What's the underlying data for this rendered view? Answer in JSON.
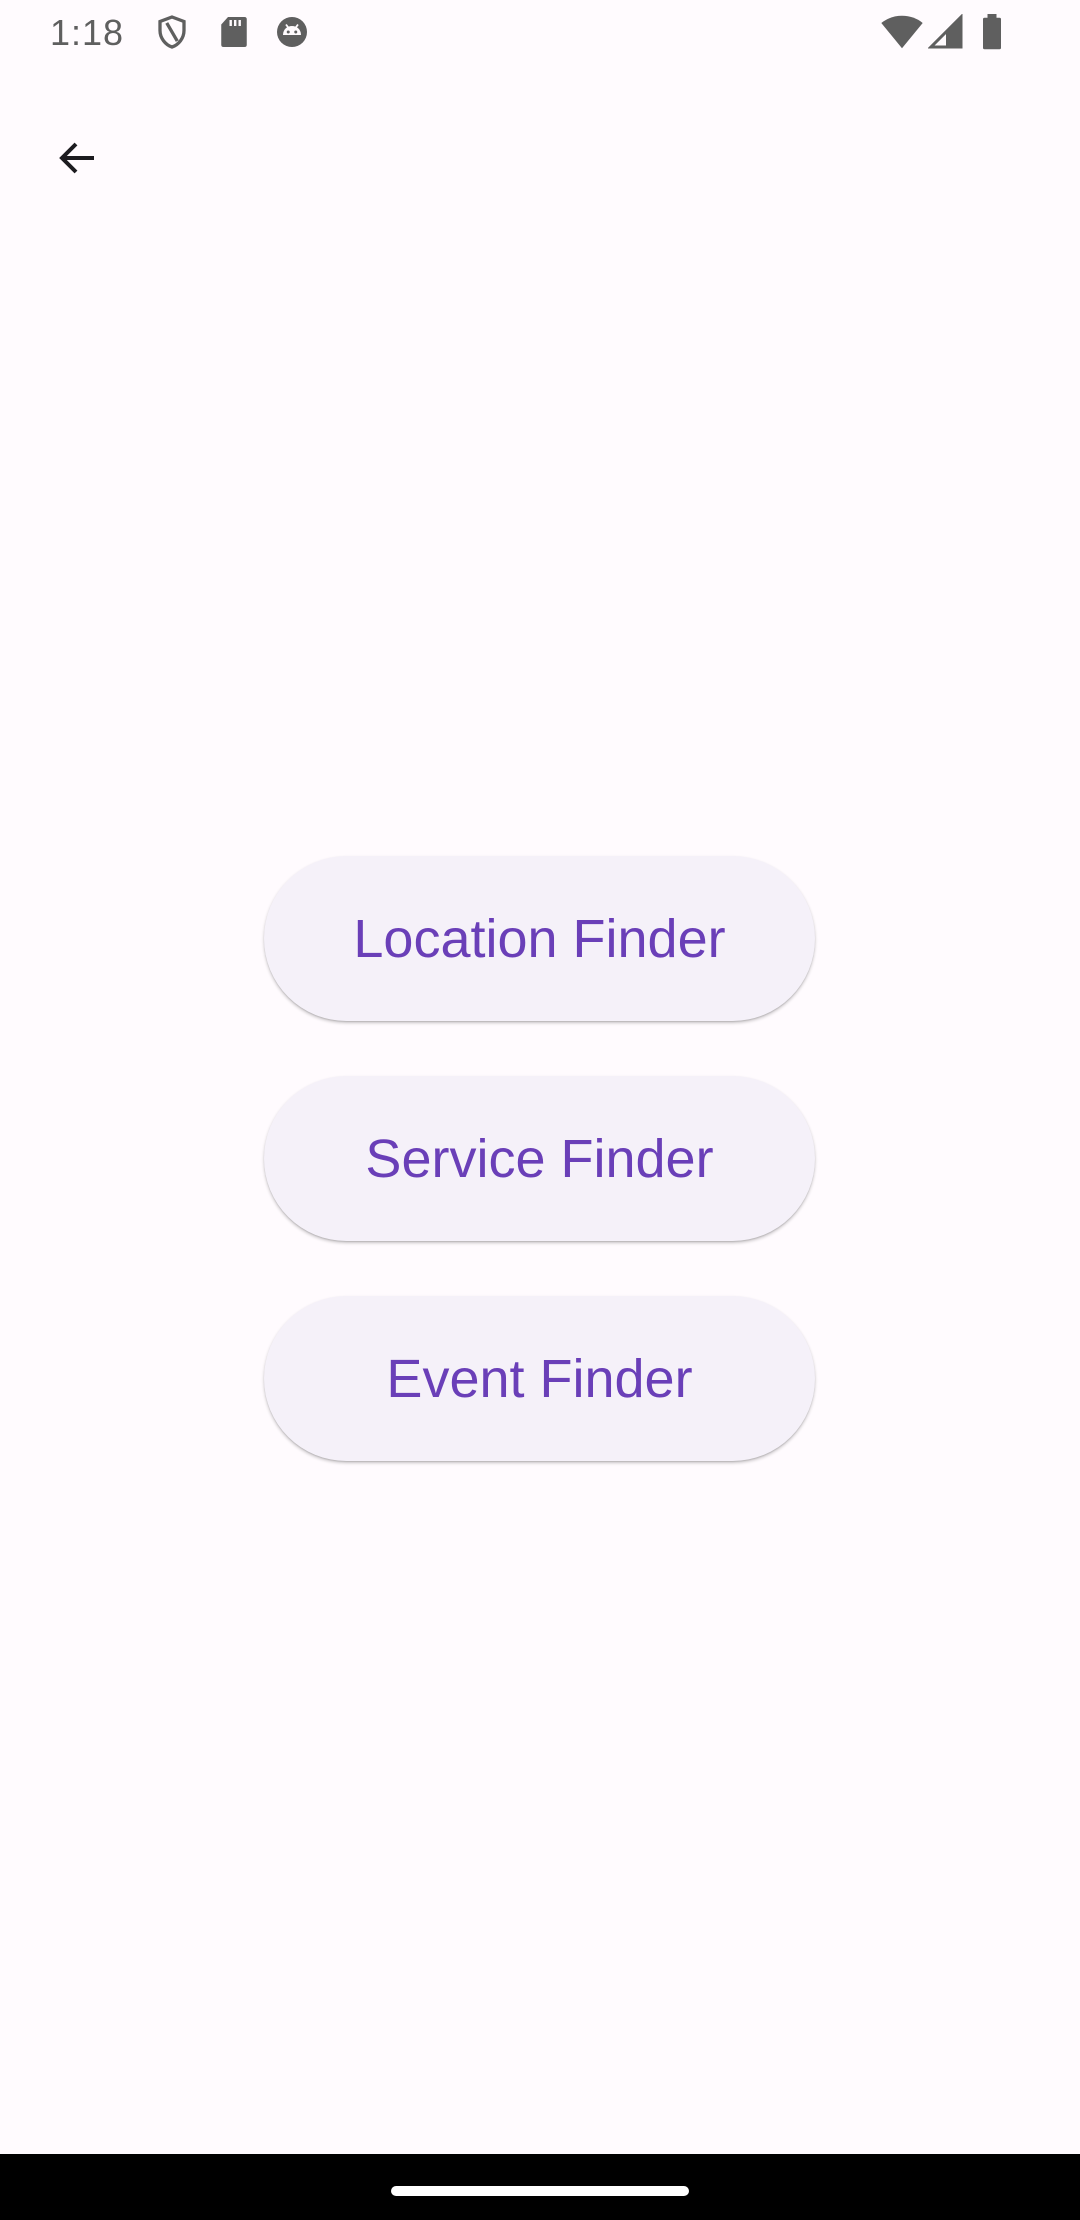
{
  "status_bar": {
    "time": "1:18",
    "icons": [
      "shield-icon",
      "sd-card-icon",
      "android-robot-icon",
      "wifi-icon",
      "cellular-signal-icon",
      "battery-icon"
    ]
  },
  "app_bar": {
    "back_icon": "arrow-back-icon"
  },
  "finder_buttons": [
    {
      "label": "Location Finder"
    },
    {
      "label": "Service Finder"
    },
    {
      "label": "Event Finder"
    }
  ],
  "colors": {
    "background": "#fffbfe",
    "button_surface": "#f5f1f9",
    "button_text": "#6a3fb8",
    "status_icons": "#5f5f5f"
  }
}
